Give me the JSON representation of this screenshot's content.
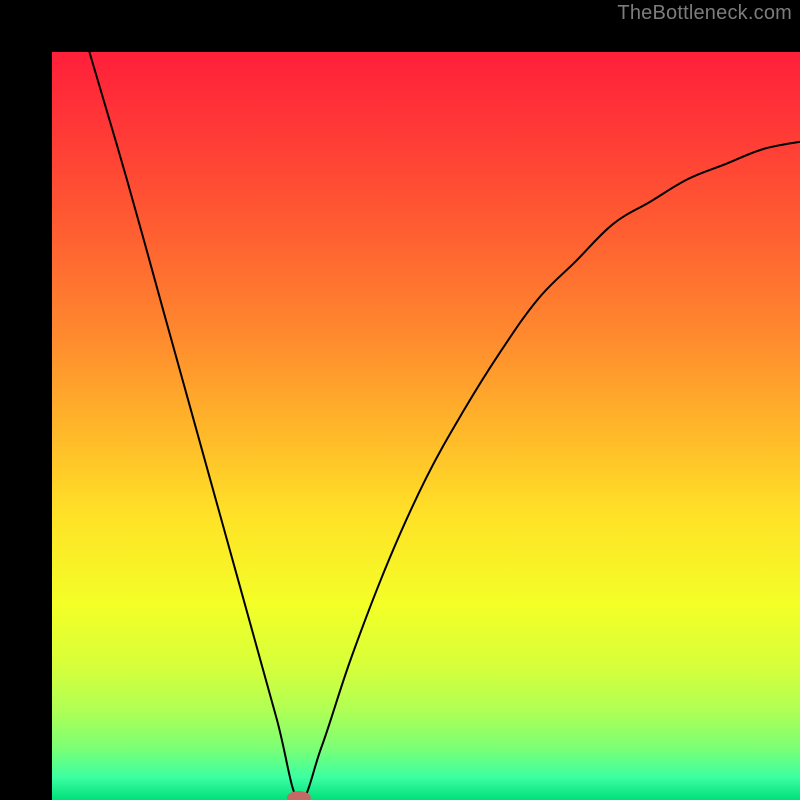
{
  "attribution": "TheBottleneck.com",
  "chart_data": {
    "type": "line",
    "title": "",
    "xlabel": "",
    "ylabel": "",
    "xlim": [
      0,
      100
    ],
    "ylim": [
      0,
      100
    ],
    "curve": {
      "name": "bottleneck-curve",
      "minimum_x": 33,
      "points": [
        {
          "x": 5,
          "y": 100
        },
        {
          "x": 10,
          "y": 83
        },
        {
          "x": 15,
          "y": 65
        },
        {
          "x": 20,
          "y": 47
        },
        {
          "x": 25,
          "y": 29
        },
        {
          "x": 30,
          "y": 11
        },
        {
          "x": 33,
          "y": 0
        },
        {
          "x": 36,
          "y": 7
        },
        {
          "x": 40,
          "y": 19
        },
        {
          "x": 45,
          "y": 32
        },
        {
          "x": 50,
          "y": 43
        },
        {
          "x": 55,
          "y": 52
        },
        {
          "x": 60,
          "y": 60
        },
        {
          "x": 65,
          "y": 67
        },
        {
          "x": 70,
          "y": 72
        },
        {
          "x": 75,
          "y": 77
        },
        {
          "x": 80,
          "y": 80
        },
        {
          "x": 85,
          "y": 83
        },
        {
          "x": 90,
          "y": 85
        },
        {
          "x": 95,
          "y": 87
        },
        {
          "x": 100,
          "y": 88
        }
      ]
    },
    "marker": {
      "x": 33,
      "y": 0,
      "rx": 1.6,
      "ry": 0.9,
      "color": "#c36a64"
    },
    "gradient_stops": [
      {
        "offset": 0.0,
        "color": "#ff1f3a"
      },
      {
        "offset": 0.12,
        "color": "#ff3d36"
      },
      {
        "offset": 0.25,
        "color": "#ff6131"
      },
      {
        "offset": 0.38,
        "color": "#ff8a2e"
      },
      {
        "offset": 0.5,
        "color": "#ffb52a"
      },
      {
        "offset": 0.62,
        "color": "#ffe227"
      },
      {
        "offset": 0.74,
        "color": "#f3ff27"
      },
      {
        "offset": 0.82,
        "color": "#d7ff3a"
      },
      {
        "offset": 0.88,
        "color": "#b0ff55"
      },
      {
        "offset": 0.93,
        "color": "#7cff74"
      },
      {
        "offset": 0.97,
        "color": "#3bffa2"
      },
      {
        "offset": 1.0,
        "color": "#00e07a"
      }
    ]
  }
}
